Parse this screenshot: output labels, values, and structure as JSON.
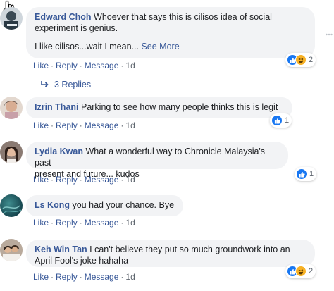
{
  "comments": [
    {
      "author": "Edward Choh",
      "text_line1": "Whoever that says this is cilisos idea of social",
      "text_line2": "experiment is genius.",
      "text_line3": "I like cilisos...wait I mean...",
      "see_more": "See More",
      "like": "Like",
      "reply": "Reply",
      "message": "Message",
      "time": "1d",
      "reaction_count": "2"
    },
    {
      "author": "Izrin Thani",
      "text_line1": "Parking to see how many people thinks this is legit",
      "like": "Like",
      "reply": "Reply",
      "message": "Message",
      "time": "1d",
      "reaction_count": "1"
    },
    {
      "author": "Lydia Kwan",
      "text_line1": "What a wonderful way to Chronicle Malaysia's past",
      "text_line2": "present and future... kudos",
      "like": "Like",
      "reply": "Reply",
      "message": "Message",
      "time": "1d",
      "reaction_count": "1"
    },
    {
      "author": "Ls Kong",
      "text_line1": "you had your chance. Bye",
      "like": "Like",
      "reply": "Reply",
      "message": "Message",
      "time": "1d"
    },
    {
      "author": "Keh Win Tan",
      "text_line1": "I can't believe they put so much groundwork into an",
      "text_line2": "April Fool's joke hahaha",
      "like": "Like",
      "reply": "Reply",
      "message": "Message",
      "time": "1d",
      "reaction_count": "2"
    }
  ],
  "replies": {
    "label": "3 Replies"
  },
  "separator": "·",
  "colors": {
    "link": "#385898",
    "bubble": "#f2f3f5",
    "like_blue": "#1877f2",
    "haha_yellow": "#f7b125",
    "meta_gray": "#606770"
  },
  "icons": [
    "hand-cursor-icon",
    "like-reaction-icon",
    "haha-reaction-icon",
    "reply-arrow-icon",
    "more-options-icon"
  ]
}
